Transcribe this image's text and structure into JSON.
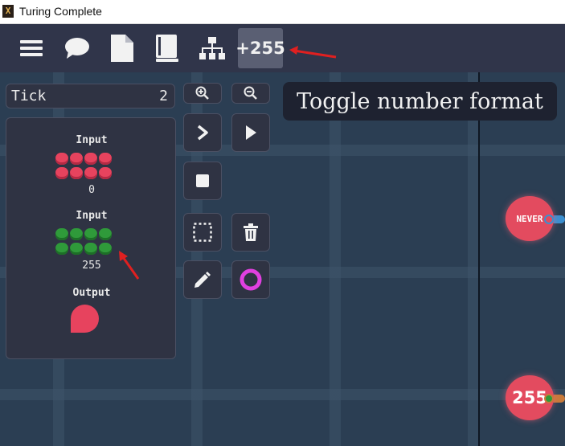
{
  "window": {
    "title": "Turing Complete"
  },
  "toolbar": {
    "items": [
      "menu-icon",
      "chat-icon",
      "document-icon",
      "book-icon",
      "hierarchy-icon"
    ],
    "number_format_label": "+255"
  },
  "tooltip": {
    "text": "Toggle number format"
  },
  "tick": {
    "label": "Tick",
    "value": "2"
  },
  "panel": {
    "input1": {
      "label": "Input",
      "value": "0",
      "color": "#e7435e"
    },
    "input2": {
      "label": "Input",
      "value": "255",
      "color": "#2f9a3a"
    },
    "output": {
      "label": "Output",
      "color": "#e7435e"
    }
  },
  "side_buttons": [
    "zoom-in-icon",
    "zoom-out-icon",
    "step-icon",
    "play-icon",
    "stop-icon",
    "select-icon",
    "delete-icon",
    "pencil-icon",
    "circle-icon"
  ],
  "canvas": {
    "node_condition": "NEVER",
    "node_value": "255"
  },
  "colors": {
    "accent_magenta": "#e040e0",
    "node_red": "#e34b5f",
    "wire_blue": "#3a8fd0",
    "wire_green": "#2f9a3a"
  }
}
